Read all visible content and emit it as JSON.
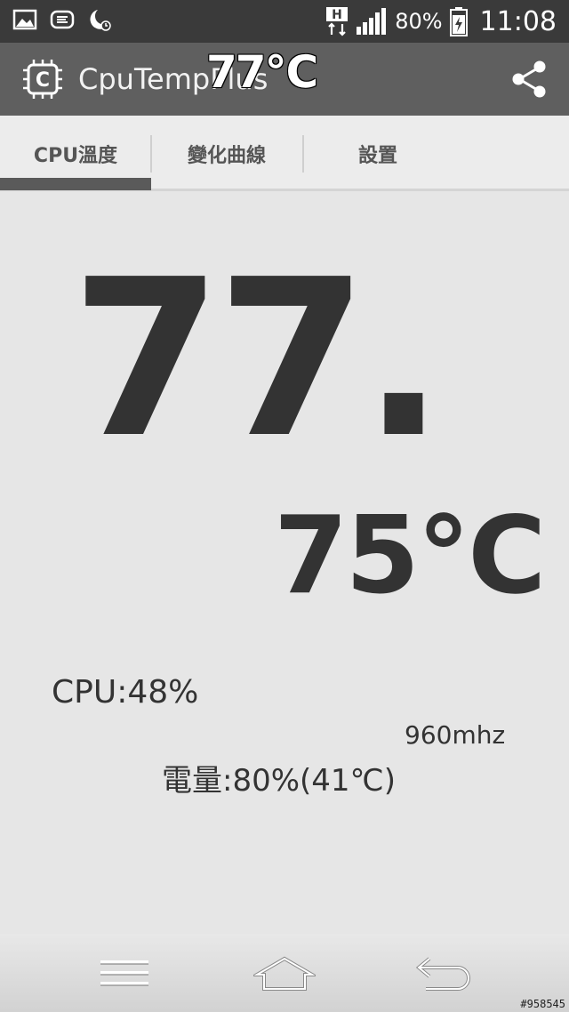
{
  "status_bar": {
    "battery_percent": "80%",
    "time": "11:08",
    "network_type": "H"
  },
  "app_bar": {
    "title": "CpuTempPlus",
    "overlay_temperature": "77℃",
    "icon_glyph": "C"
  },
  "tabs": [
    {
      "label": "CPU溫度",
      "selected": true
    },
    {
      "label": "變化曲線",
      "selected": false
    },
    {
      "label": "設置",
      "selected": false
    }
  ],
  "main": {
    "temperature_integer": "77.",
    "temperature_fraction": "75℃",
    "cpu_usage": "CPU:48%",
    "cpu_frequency": "960mhz",
    "battery_info": "電量:80%(41℃)"
  },
  "watermark": "#958545",
  "colors": {
    "status_bar": "#3a3a3a",
    "app_bar": "#5f5f5f",
    "background": "#e6e6e6",
    "tab_indicator": "#5a5a5a",
    "text": "#333333"
  }
}
